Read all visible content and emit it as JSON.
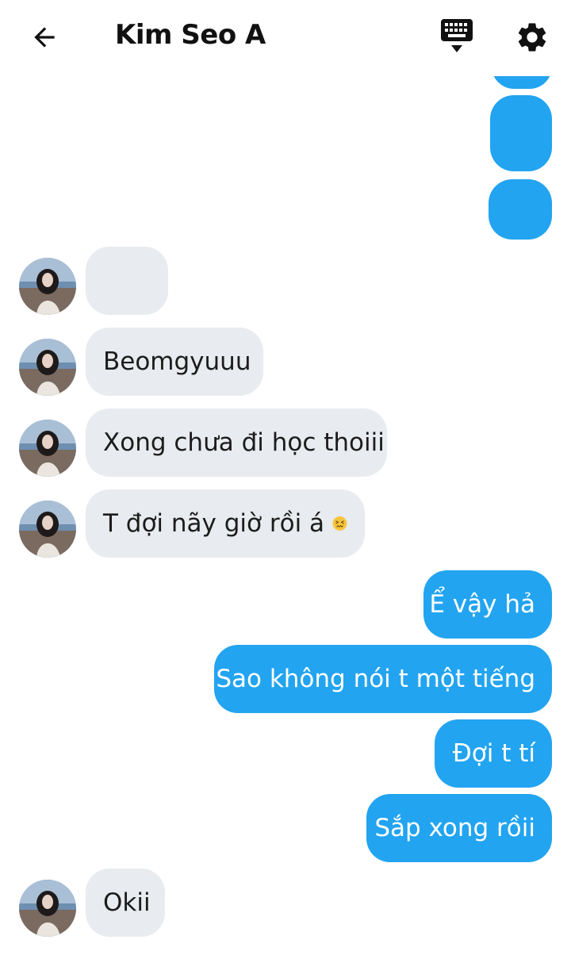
{
  "header": {
    "title": "Kim Seo A",
    "back_icon": "arrow-left-icon",
    "keyboard_icon": "keyboard-icon",
    "settings_icon": "gear-icon"
  },
  "colors": {
    "outgoing_bubble": "#22a4f0",
    "incoming_bubble": "#e8ebef",
    "icon": "#111111"
  },
  "messages": [
    {
      "side": "out",
      "text": ""
    },
    {
      "side": "out",
      "text": ""
    },
    {
      "side": "out",
      "text": ""
    },
    {
      "side": "in",
      "text": ""
    },
    {
      "side": "in",
      "text": "Beomgyuuu"
    },
    {
      "side": "in",
      "text": "Xong chưa đi học thoiii"
    },
    {
      "side": "in",
      "text": "T đợi nãy giờ rồi á",
      "emoji": "confounded-face-icon"
    },
    {
      "side": "out",
      "text": "Ể vậy hả"
    },
    {
      "side": "out",
      "text": "Sao không nói t một tiếng"
    },
    {
      "side": "out",
      "text": "Đợi t tí"
    },
    {
      "side": "out",
      "text": "Sắp xong rồii"
    },
    {
      "side": "in",
      "text": "Okii"
    }
  ]
}
